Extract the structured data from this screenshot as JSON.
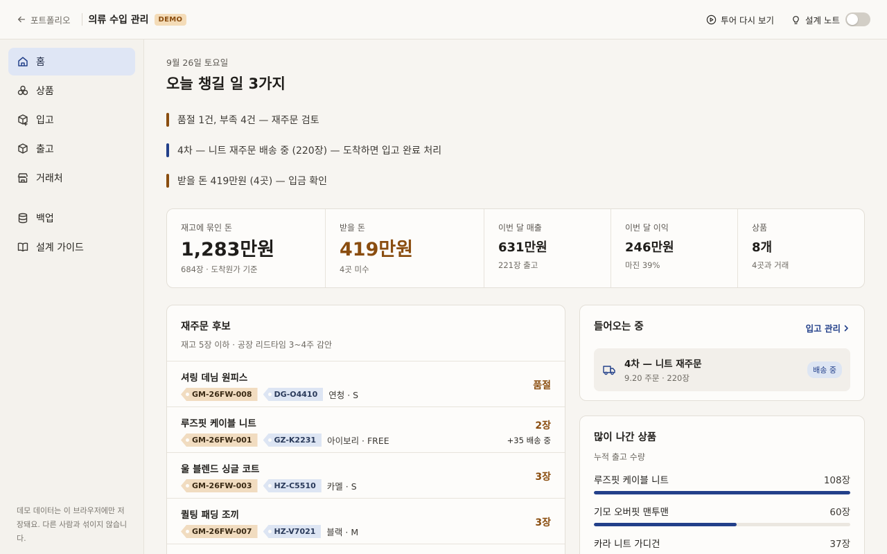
{
  "topbar": {
    "back_label": "포트폴리오",
    "app_title": "의류 수입 관리",
    "demo_badge": "DEMO",
    "tour_label": "투어 다시 보기",
    "notes_label": "설계 노트",
    "notes_toggle_on": false
  },
  "sidebar": {
    "items": [
      {
        "label": "홈",
        "icon": "home-icon",
        "active": true
      },
      {
        "label": "상품",
        "icon": "products-icon"
      },
      {
        "label": "입고",
        "icon": "inbound-box-icon"
      },
      {
        "label": "출고",
        "icon": "outbound-box-icon"
      },
      {
        "label": "거래처",
        "icon": "store-icon"
      },
      {
        "label": "백업",
        "icon": "database-icon"
      },
      {
        "label": "설계 가이드",
        "icon": "book-icon"
      }
    ],
    "note": "데모 데이터는 이 브라우저에만 저장돼요. 다른 사람과 섞이지 않습니다."
  },
  "main": {
    "date": "9월 26일 토요일",
    "headline": "오늘 챙길 일 3가지",
    "tasks": [
      {
        "text": "품절 1건, 부족 4건 — 재주문 검토",
        "color": "#8a4d0f"
      },
      {
        "text": "4차 — 니트 재주문 배송 중 (220장) — 도착하면 입고 완료 처리",
        "color": "#23408a"
      },
      {
        "text": "받을 돈 419만원 (4곳) — 입금 확인",
        "color": "#8a4d0f"
      }
    ]
  },
  "stats": [
    {
      "label": "재고에 묶인 돈",
      "value": "1,283만원",
      "sub": "684장 · 도착원가 기준"
    },
    {
      "label": "받을 돈",
      "value": "419만원",
      "sub": "4곳 미수"
    },
    {
      "label": "이번 달 매출",
      "value": "631만원",
      "sub": "221장 출고"
    },
    {
      "label": "이번 달 이익",
      "value": "246만원",
      "sub": "마진 39%"
    },
    {
      "label": "상품",
      "value": "8개",
      "sub": "4곳과 거래"
    }
  ],
  "reorder": {
    "title": "재주문 후보",
    "subtitle": "재고 5장 이하 · 공장 리드타임 3~4주 감안",
    "rows": [
      {
        "name": "셔링 데님 원피스",
        "sku": "GM-26FW-008",
        "factory_code": "DG-O4410",
        "variant": "연청 · S",
        "stock": "품절",
        "incoming": ""
      },
      {
        "name": "루즈핏 케이블 니트",
        "sku": "GM-26FW-001",
        "factory_code": "GZ-K2231",
        "variant": "아이보리 · FREE",
        "stock": "2장",
        "incoming": "+35 배송 중"
      },
      {
        "name": "울 블렌드 싱글 코트",
        "sku": "GM-26FW-003",
        "factory_code": "HZ-C5510",
        "variant": "카멜 · S",
        "stock": "3장",
        "incoming": ""
      },
      {
        "name": "퀼팅 패딩 조끼",
        "sku": "GM-26FW-007",
        "factory_code": "HZ-V7021",
        "variant": "블랙 · M",
        "stock": "3장",
        "incoming": ""
      }
    ]
  },
  "incoming": {
    "title": "들어오는 중",
    "link_label": "입고 관리",
    "shipment": {
      "title": "4차 — 니트 재주문",
      "sub": "9.20 주문 · 220장",
      "status": "배송 중"
    }
  },
  "top_products": {
    "title": "많이 나간 상품",
    "subtitle": "누적 출고 수량",
    "items": [
      {
        "name": "루즈핏 케이블 니트",
        "qty": "108장",
        "value": 108
      },
      {
        "name": "기모 오버핏 맨투맨",
        "qty": "60장",
        "value": 60
      },
      {
        "name": "카라 니트 가디건",
        "qty": "37장",
        "value": 37
      }
    ],
    "max": 108
  },
  "colors": {
    "accent": "#23408a",
    "warning": "#8a4d0f",
    "active_nav_bg": "#dfe6f5"
  }
}
